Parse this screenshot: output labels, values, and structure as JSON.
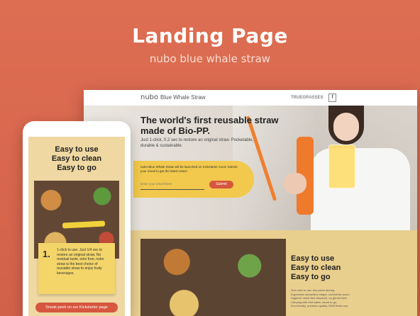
{
  "hero": {
    "title": "Landing Page",
    "subtitle": "nubo blue whale straw"
  },
  "desktop": {
    "nav": {
      "logo": "nubo",
      "logo_text": "Blue Whale Straw",
      "brand": "TRUEGRASSES",
      "fb_icon": "facebook-icon"
    },
    "headline": "The world's first reusable straw made of Bio-PP.",
    "body": "Just 1-click, 0.2 sec to restore an original straw. Pocketable, durable & sustainable.",
    "form": {
      "message": "nubo Blue Whale Straw will be launched on Kickstarter soon! Submit your email to get the latest news!",
      "placeholder": "Enter your email here!",
      "submit": "Submit"
    },
    "lower": {
      "title_lines": [
        "Easy to use",
        "Easy to clean",
        "Easy to go"
      ],
      "list": [
        "One-click to use, two-piece storing.",
        "Ergonomic streamline shape, comfort lip-touch.",
        "Hygienic notch-free structure, no germs hide.",
        "Carrying with fruit water, smart to go.",
        "Eco-friendly, premium quality, 5000 times use."
      ]
    }
  },
  "phone": {
    "title_lines": [
      "Easy to use",
      "Easy to clean",
      "Easy to go"
    ],
    "step_number": "1.",
    "step_text": "1-click to use. Just 1/4 sec to restore an original straw. No residual taste, odor free, nubo straw is the best choice of reusable straw to enjoy fruity beverages.",
    "cta": "Sneak peek on our Kickstarter page"
  },
  "colors": {
    "background": "#d8654c",
    "accent": "#d7573e",
    "yellow": "#f2c94c"
  }
}
